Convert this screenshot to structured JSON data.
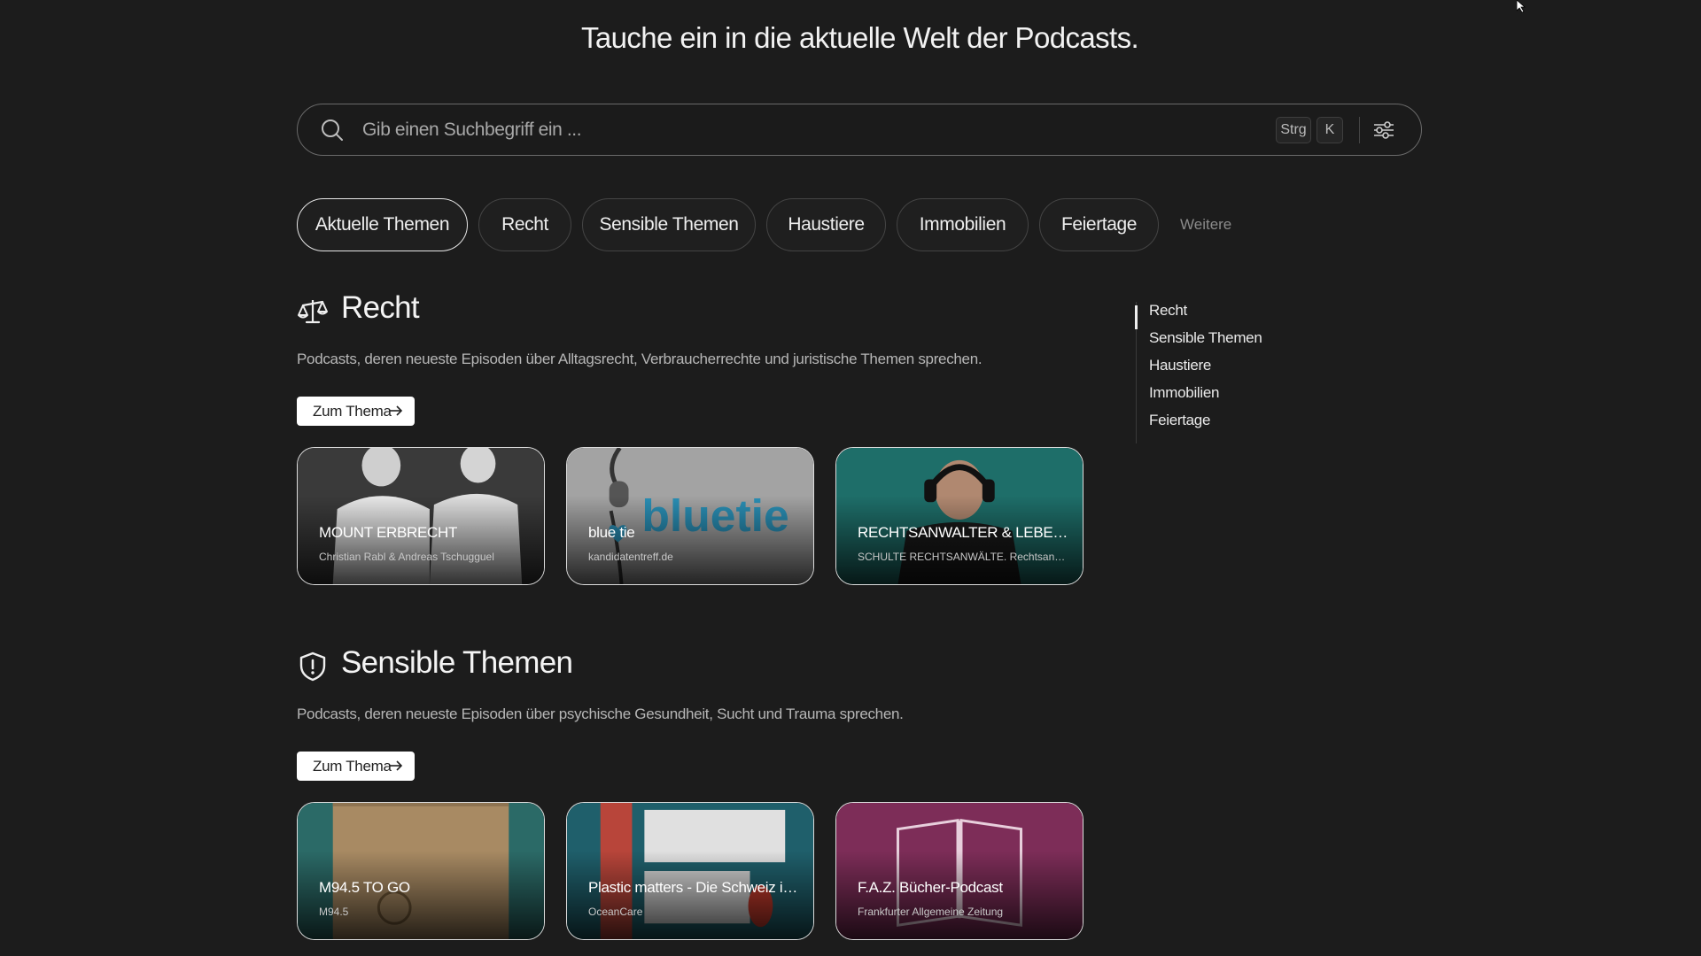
{
  "header": {
    "title": "Tauche ein in die aktuelle Welt der Podcasts."
  },
  "search": {
    "placeholder": "Gib einen Suchbegriff ein ...",
    "value": "",
    "shortcut_modifier": "Strg",
    "shortcut_key": "K",
    "search_icon": "search-icon",
    "filter_icon": "sliders-icon"
  },
  "tabs": {
    "items": [
      {
        "label": "Aktuelle Themen",
        "active": true
      },
      {
        "label": "Recht",
        "active": false
      },
      {
        "label": "Sensible Themen",
        "active": false
      },
      {
        "label": "Haustiere",
        "active": false
      },
      {
        "label": "Immobilien",
        "active": false
      },
      {
        "label": "Feiertage",
        "active": false
      }
    ],
    "more_label": "Weitere"
  },
  "sections": [
    {
      "title": "Recht",
      "icon": "scales-icon",
      "description": "Podcasts, deren neueste Episoden über Alltagsrecht, Verbraucherrechte und juristische Themen sprechen.",
      "button_label": "Zum Thema",
      "cards": [
        {
          "title": "MOUNT ERBRECHT",
          "subtitle": "Christian Rabl & Andreas Tschugguel",
          "color": "#3b3b3b"
        },
        {
          "title": "blue tie",
          "subtitle": "kandidatentreff.de",
          "color": "#9a9a9a"
        },
        {
          "title": "RECHTSANWALTER & LEBENSKÜNSTLER",
          "subtitle": "SCHULTE RECHTSANWÄLTE. Rechtsanwaltsgesellschaft",
          "color": "#1b6f6a"
        }
      ]
    },
    {
      "title": "Sensible Themen",
      "icon": "shield-alert-icon",
      "description": "Podcasts, deren neueste Episoden über psychische Gesundheit, Sucht und Trauma sprechen.",
      "button_label": "Zum Thema",
      "cards": [
        {
          "title": "M94.5 TO GO",
          "subtitle": "M94.5",
          "color": "#2a6a66"
        },
        {
          "title": "Plastic matters - Die Schweiz im Kampf gegen Plastik",
          "subtitle": "OceanCare",
          "color": "#1f5f6b"
        },
        {
          "title": "F.A.Z. Bücher-Podcast",
          "subtitle": "Frankfurter Allgemeine Zeitung",
          "color": "#7a2a56"
        }
      ]
    }
  ],
  "toc": {
    "items": [
      "Recht",
      "Sensible Themen",
      "Haustiere",
      "Immobilien",
      "Feiertage"
    ],
    "active": "Recht"
  }
}
